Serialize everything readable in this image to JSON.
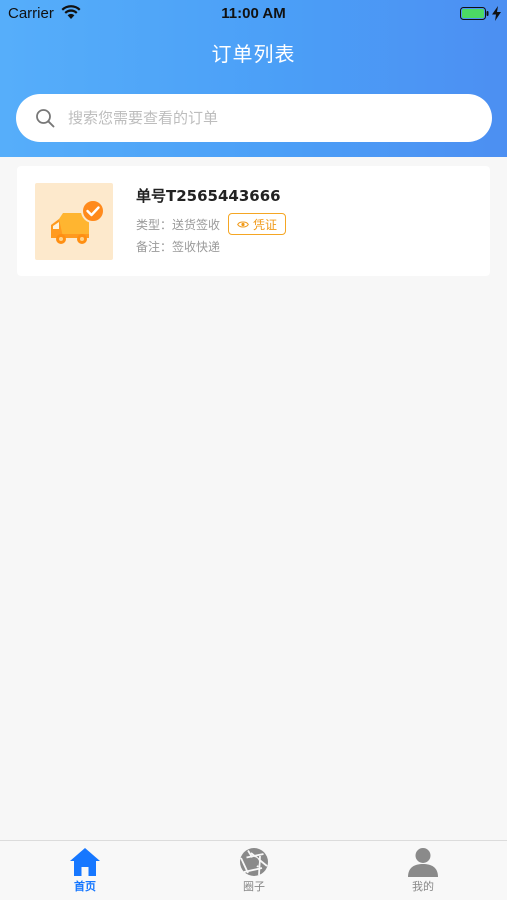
{
  "status_bar": {
    "carrier": "Carrier",
    "time": "11:00 AM"
  },
  "header": {
    "title": "订单列表"
  },
  "search": {
    "placeholder": "搜索您需要查看的订单",
    "value": ""
  },
  "orders": [
    {
      "order_no": "单号T2565443666",
      "type_label": "类型：",
      "type_value": "送货签收",
      "voucher_label": "凭证",
      "note_label": "备注：",
      "note_value": "签收快递",
      "thumb_icon": "delivery-truck-check-icon"
    }
  ],
  "tabs": [
    {
      "label": "首页",
      "icon": "home-icon",
      "active": true
    },
    {
      "label": "圈子",
      "icon": "aperture-icon",
      "active": false
    },
    {
      "label": "我的",
      "icon": "user-icon",
      "active": false
    }
  ],
  "colors": {
    "accent": "#1677ff",
    "header_start": "#56aefa",
    "header_end": "#4c8ff2",
    "voucher": "#f5a623",
    "battery": "#4cd964"
  }
}
